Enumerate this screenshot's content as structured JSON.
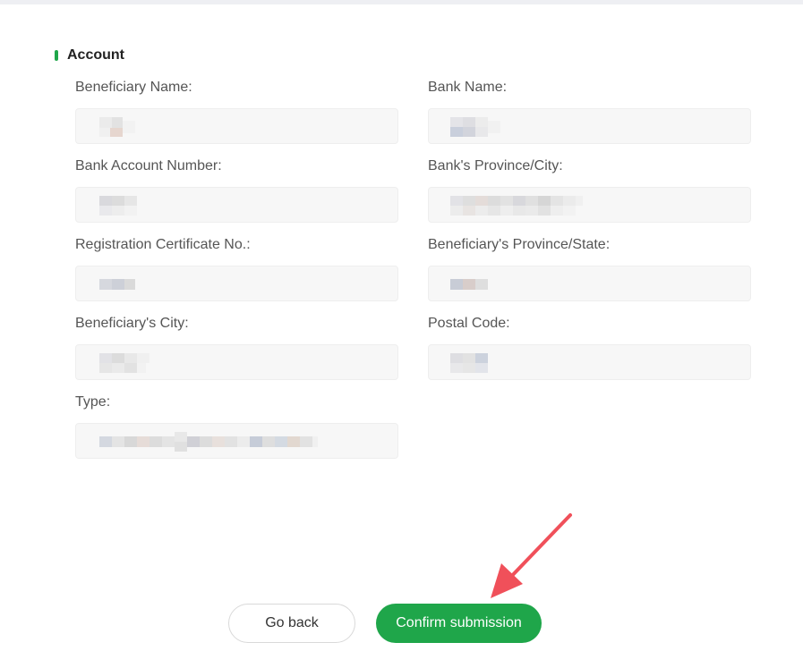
{
  "section": {
    "title": "Account"
  },
  "fields": [
    {
      "label": "Beneficiary Name:",
      "value": ""
    },
    {
      "label": "Bank Name:",
      "value": ""
    },
    {
      "label": "Bank Account Number:",
      "value": ""
    },
    {
      "label": "Bank's Province/City:",
      "value": ""
    },
    {
      "label": "Registration Certificate No.:",
      "value": ""
    },
    {
      "label": "Beneficiary's Province/State:",
      "value": ""
    },
    {
      "label": "Beneficiary's City:",
      "value": ""
    },
    {
      "label": "Postal Code:",
      "value": ""
    },
    {
      "label": "Type:",
      "value": ""
    }
  ],
  "actions": {
    "back_label": "Go back",
    "confirm_label": "Confirm submission"
  },
  "colors": {
    "accent": "#1fa64a",
    "annotation_arrow": "#f0505a"
  }
}
